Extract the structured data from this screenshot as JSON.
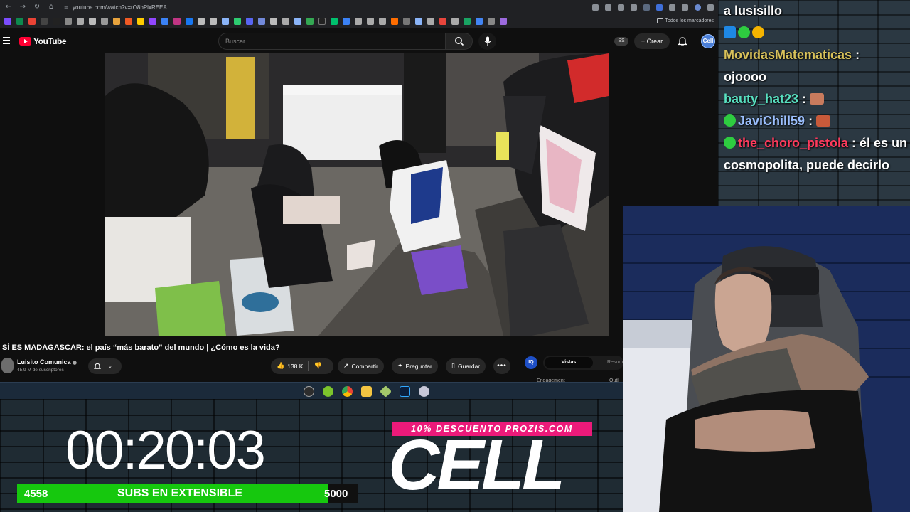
{
  "browser": {
    "url": "youtube.com/watch?v=rO8bPlxREEA",
    "bookmarks_all_label": "Todos los marcadores"
  },
  "youtube": {
    "logo_text": "YouTube",
    "search_placeholder": "Buscar",
    "ss_badge": "SS",
    "create_label": "Crear",
    "avatar_text": "Cell"
  },
  "video": {
    "title": "SÍ ES MADAGASCAR: el país “más barato” del mundo | ¿Cómo es la vida?",
    "channel": "Luisito Comunica",
    "subscribers": "45,9 M de suscriptores",
    "likes": "138 K",
    "share_label": "Compartir",
    "ask_label": "Preguntar",
    "save_label": "Guardar"
  },
  "side_panel": {
    "logo": "IQ",
    "tab_active": "Vistas",
    "tab_other": "Resum",
    "engagement_label": "Engagement",
    "outliers_label": "Outli"
  },
  "overlay": {
    "timer": "00:20:03",
    "subs_current": "4558",
    "subs_label": "SUBS EN EXTENSIBLE",
    "subs_goal": "5000",
    "subs_progress": 0.9116,
    "promo": "10% DESCUENTO PROZIS.COM",
    "brand": "CELL"
  },
  "chat": [
    {
      "user": "",
      "message": "a lusisillo",
      "user_color": "#ffffff"
    },
    {
      "user": "MovidasMatematicas",
      "message": "ojoooo",
      "user_color": "#d9c25a"
    },
    {
      "user": "bauty_hat23",
      "message": "",
      "user_color": "#58e0c0"
    },
    {
      "user": "JaviChill59",
      "message": "",
      "user_color": "#9cc0ff"
    },
    {
      "user": "the_choro_pistola",
      "message": "él es un cosmopolita, puede decirlo",
      "user_color": "#ff3a5c"
    }
  ],
  "colors": {
    "accent_red": "#ff0033",
    "subs_green": "#16c80e",
    "promo_pink": "#ec1a7a"
  }
}
